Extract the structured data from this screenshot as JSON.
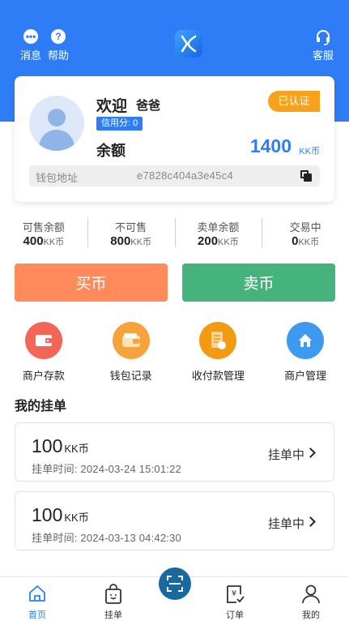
{
  "header": {
    "messages_label": "消息",
    "help_label": "帮助",
    "service_label": "客服"
  },
  "profile": {
    "welcome": "欢迎",
    "username": "爸爸",
    "credit": "信用分: 0",
    "verified_badge": "已认证",
    "balance_label": "余额",
    "balance_value": "1400",
    "balance_unit": "KK币",
    "wallet_label": "钱包地址",
    "wallet_address": "e7828c404a3e45c4"
  },
  "stats": [
    {
      "label": "可售余额",
      "value": "400",
      "unit": "KK币"
    },
    {
      "label": "不可售",
      "value": "800",
      "unit": "KK币"
    },
    {
      "label": "卖单余额",
      "value": "200",
      "unit": "KK币"
    },
    {
      "label": "交易中",
      "value": "0",
      "unit": "KK币"
    }
  ],
  "actions": {
    "buy_label": "买币",
    "sell_label": "卖币"
  },
  "menu": [
    {
      "label": "商户存款",
      "icon": "wallet-icon",
      "color": "#f26557"
    },
    {
      "label": "钱包记录",
      "icon": "purse-icon",
      "color": "#f5a33a"
    },
    {
      "label": "收付款管理",
      "icon": "document-icon",
      "color": "#f29a12"
    },
    {
      "label": "商户管理",
      "icon": "home-icon",
      "color": "#3d9af0"
    }
  ],
  "orders_section": {
    "title": "我的挂单",
    "items": [
      {
        "amount": "100",
        "unit": "KK币",
        "time": "挂单时间: 2024-03-24 15:01:22",
        "status": "挂单中"
      },
      {
        "amount": "100",
        "unit": "KK币",
        "time": "挂单时间: 2024-03-13 04:42:30",
        "status": "挂单中"
      }
    ]
  },
  "tabbar": {
    "home": "首页",
    "orders_list": "挂单",
    "orders": "订单",
    "mine": "我的",
    "active_color": "#2f7df6"
  },
  "colors": {
    "brand": "#2f7df6",
    "buy": "#ff8a5c",
    "sell": "#46b37c",
    "verified": "#f7a21b"
  }
}
